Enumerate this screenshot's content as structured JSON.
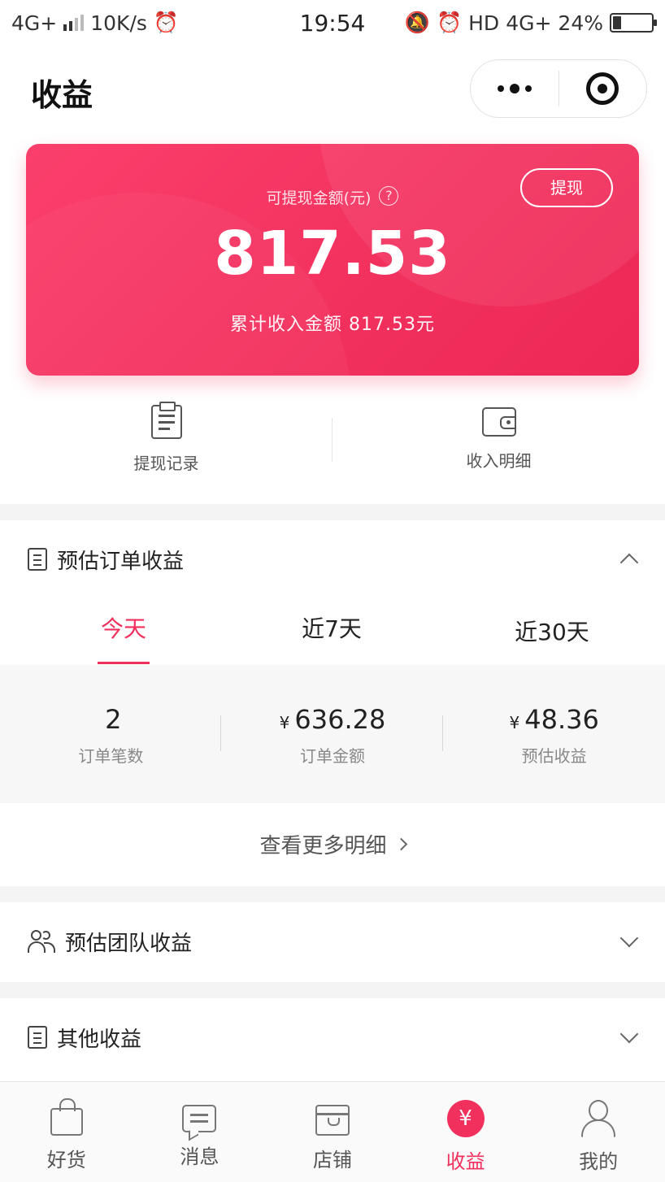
{
  "status_bar": {
    "network": "4G+",
    "speed": "10K/s",
    "time": "19:54",
    "hd": "HD",
    "network2": "4G+",
    "battery": "24%"
  },
  "header": {
    "title": "收益"
  },
  "card": {
    "label": "可提现金额(元)",
    "help": "?",
    "amount": "817.53",
    "total": "累计收入金额 817.53元",
    "withdraw_label": "提现",
    "accent": "#f2305d"
  },
  "shortcuts": [
    {
      "label": "提现记录",
      "icon": "clipboard-icon"
    },
    {
      "label": "收入明细",
      "icon": "wallet-icon"
    }
  ],
  "order_section": {
    "title": "预估订单收益",
    "tabs": [
      "今天",
      "近7天",
      "近30天"
    ],
    "active_tab": 0,
    "stats": [
      {
        "value": "2",
        "currency": "",
        "label": "订单笔数"
      },
      {
        "value": "636.28",
        "currency": "¥",
        "label": "订单金额"
      },
      {
        "value": "48.36",
        "currency": "¥",
        "label": "预估收益"
      }
    ],
    "more_label": "查看更多明细"
  },
  "team_section": {
    "title": "预估团队收益"
  },
  "other_section": {
    "title": "其他收益"
  },
  "tab_bar": {
    "items": [
      {
        "label": "好货",
        "icon": "bag-icon"
      },
      {
        "label": "消息",
        "icon": "message-icon"
      },
      {
        "label": "店铺",
        "icon": "shop-icon"
      },
      {
        "label": "收益",
        "icon": "yuan-icon",
        "glyph": "¥"
      },
      {
        "label": "我的",
        "icon": "user-icon"
      }
    ],
    "active": 3
  }
}
